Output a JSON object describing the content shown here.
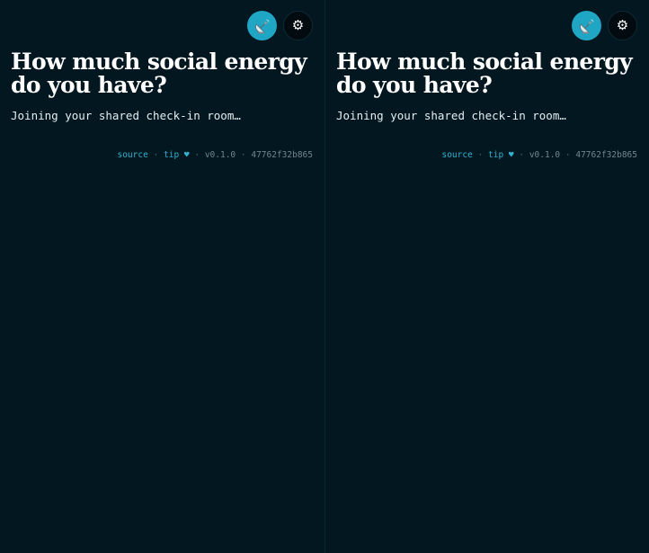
{
  "panes": [
    {
      "title": "How much social energy do you have?",
      "subtitle": "Joining your shared check-in room…",
      "footer": {
        "source_label": "source",
        "separator": "·",
        "tip_label": "tip ♥",
        "version": "v0.1.0",
        "commit": "47762f32b865"
      },
      "icons": {
        "broadcast": "satellite-dish-icon",
        "settings": "gear-icon"
      }
    },
    {
      "title": "How much social energy do you have?",
      "subtitle": "Joining your shared check-in room…",
      "footer": {
        "source_label": "source",
        "separator": "·",
        "tip_label": "tip ♥",
        "version": "v0.1.0",
        "commit": "47762f32b865"
      },
      "icons": {
        "broadcast": "satellite-dish-icon",
        "settings": "gear-icon"
      }
    }
  ],
  "colors": {
    "background": "#031720",
    "accent": "#1ea6c4",
    "link": "#2fb4d1",
    "text": "#ffffff",
    "muted": "#6f8790"
  },
  "glyphs": {
    "settings": "⚙"
  }
}
